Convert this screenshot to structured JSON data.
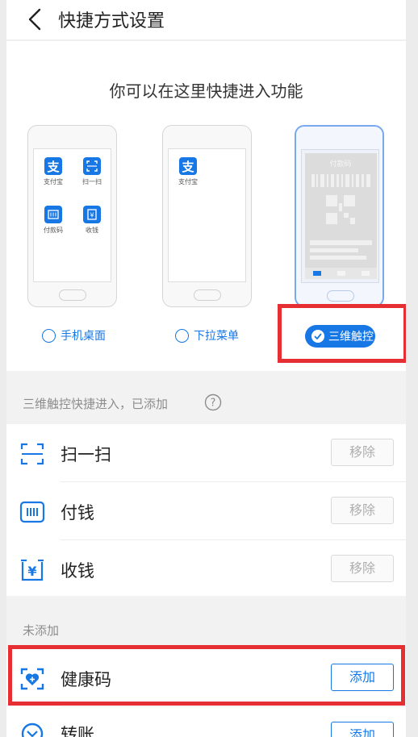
{
  "header": {
    "title": "快捷方式设置"
  },
  "intro": {
    "heading": "你可以在这里快捷进入功能",
    "desktop_apps": [
      "支付宝",
      "扫一扫",
      "付款码",
      "收钱"
    ],
    "dropdown_apps": [
      "支付宝"
    ],
    "preview_title": "付款码"
  },
  "options": [
    {
      "label": "手机桌面",
      "selected": false
    },
    {
      "label": "下拉菜单",
      "selected": false
    },
    {
      "label": "三维触控",
      "selected": true
    }
  ],
  "added_section": {
    "title": "三维触控快捷进入，已添加"
  },
  "added_items": [
    {
      "label": "扫一扫",
      "icon": "scan-icon",
      "action": "移除"
    },
    {
      "label": "付钱",
      "icon": "pay-code-icon",
      "action": "移除"
    },
    {
      "label": "收钱",
      "icon": "receive-money-icon",
      "action": "移除"
    }
  ],
  "not_added_section": {
    "title": "未添加"
  },
  "not_added_items": [
    {
      "label": "健康码",
      "icon": "health-code-icon",
      "action": "添加"
    },
    {
      "label": "转账",
      "icon": "transfer-icon",
      "action": "添加"
    }
  ],
  "colors": {
    "accent": "#1677e5",
    "highlight": "#e52f33",
    "background": "#f2f2f2"
  }
}
